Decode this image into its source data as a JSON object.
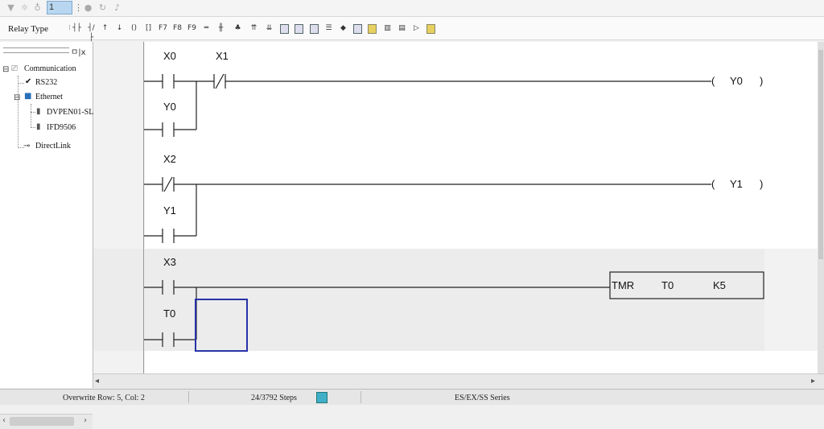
{
  "toolbar_top": {
    "station_value": "1",
    "icons": [
      "plc-icon",
      "monitor-icon",
      "settings-icon",
      "spin-up-icon",
      "record-icon",
      "refresh-icon",
      "signal-icon"
    ]
  },
  "toolbar2": {
    "mode_label": "Relay Type",
    "icons": [
      "contact-no-icon",
      "contact-nc-icon",
      "rising-icon",
      "falling-icon",
      "coil-icon",
      "function-icon",
      "f7-icon",
      "f8-icon",
      "f9-icon",
      "horizontal-line-icon",
      "vertical-line-icon",
      "delete-line-icon",
      "up-icon",
      "down-icon",
      "insert-icon",
      "comment-icon",
      "device-icon",
      "compile-icon",
      "monitor-icon",
      "mail-icon",
      "memory-icon",
      "io-icon",
      "trace-icon",
      "register-icon"
    ]
  },
  "sidebar": {
    "header_buttons": "ㅁ|x",
    "tree": {
      "root": "Communication",
      "rs232": "RS232",
      "ethernet": "Ethernet",
      "dev1": "DVPEN01-SL",
      "dev2": "IFD9506",
      "directlink": "DirectLink"
    }
  },
  "ladder": {
    "rungs": [
      {
        "contact1": "X0",
        "contact2": "X1",
        "branch": "Y0",
        "coil": "Y0"
      },
      {
        "contact1": "X2",
        "branch": "Y1",
        "coil": "Y1"
      },
      {
        "contact1": "X3",
        "branch": "T0",
        "instr": {
          "op": "TMR",
          "arg1": "T0",
          "arg2": "K5"
        }
      }
    ]
  },
  "coil_open": "(",
  "coil_close": ")",
  "status_bar": {
    "mode": "Overwrite  Row: 5, Col: 2",
    "steps": "24/3792 Steps",
    "series": "ES/EX/SS Series"
  },
  "colors": {
    "cursor_box": "#2833a8",
    "band": "#ececec",
    "indicator": "#3fb0c8"
  }
}
